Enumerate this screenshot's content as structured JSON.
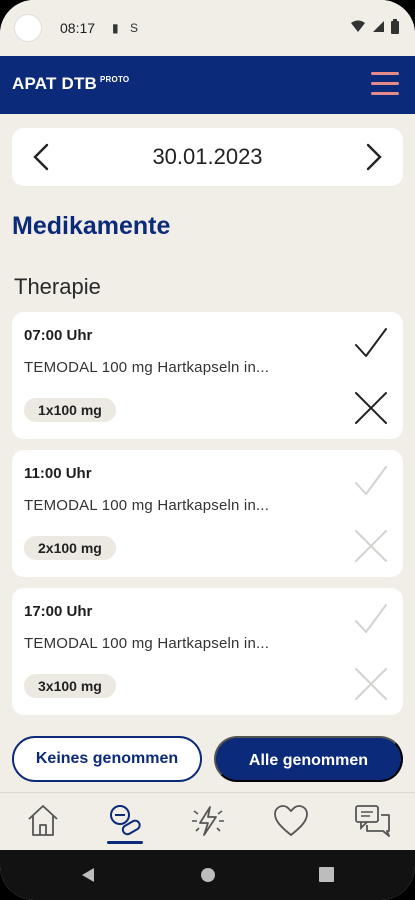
{
  "status_bar": {
    "time": "08:17",
    "icons": [
      "camera-icon",
      "sd-card-icon",
      "sim-icon",
      "wifi-icon",
      "signal-icon",
      "battery-icon"
    ]
  },
  "app": {
    "brand": "APAT DTB",
    "brand_sup": "PROTO"
  },
  "date": {
    "value": "30.01.2023"
  },
  "section": {
    "title": "Medikamente",
    "subtitle": "Therapie"
  },
  "doses": [
    {
      "time": "07:00 Uhr",
      "drug": "TEMODAL 100 mg Hartkapseln in...",
      "amount": "1x100 mg",
      "active": true
    },
    {
      "time": "11:00 Uhr",
      "drug": "TEMODAL 100 mg Hartkapseln in...",
      "amount": "2x100 mg",
      "active": false
    },
    {
      "time": "17:00 Uhr",
      "drug": "TEMODAL 100 mg Hartkapseln in...",
      "amount": "3x100 mg",
      "active": false
    }
  ],
  "actions": {
    "none_label": "Keines genommen",
    "all_label": "Alle genommen"
  },
  "nav": [
    "home-icon",
    "medication-icon",
    "symptoms-icon",
    "wellbeing-icon",
    "messages-icon"
  ],
  "colors": {
    "primary": "#0b2a7a",
    "accent": "#e58a86",
    "background": "#f1eee8"
  }
}
